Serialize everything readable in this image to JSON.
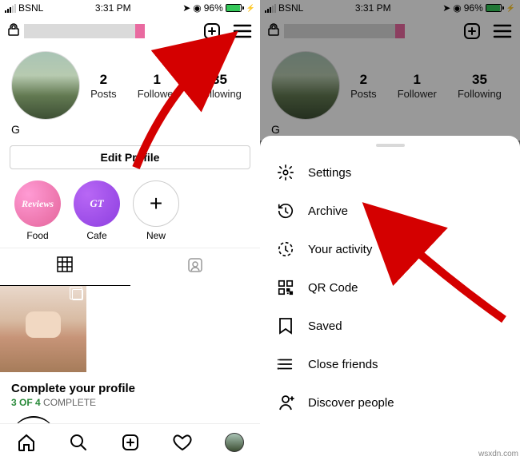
{
  "status": {
    "carrier": "BSNL",
    "time": "3:31 PM",
    "alarm_icon": "alarm",
    "loc_icon": "location",
    "battery_pct": "96%",
    "bolt": "bolt"
  },
  "topbar": {
    "lock_icon": "lock",
    "username": "(redacted)",
    "create_icon": "create",
    "menu_icon": "menu"
  },
  "profile": {
    "posts_num": "2",
    "posts_lbl": "Posts",
    "followers_num": "1",
    "followers_lbl": "Follower",
    "following_num": "35",
    "following_lbl": "Following",
    "display_name": "G",
    "edit_label": "Edit Profile"
  },
  "highlights": {
    "food": {
      "label": "Food",
      "text": "Reviews"
    },
    "cafe": {
      "label": "Cafe",
      "text": "GT"
    },
    "new": {
      "label": "New",
      "text": "+"
    }
  },
  "tabs": {
    "grid": "grid",
    "tagged": "tagged"
  },
  "complete": {
    "heading": "Complete your profile",
    "progress_bold": "3 OF 4",
    "progress_rest": " COMPLETE"
  },
  "bottomnav": {
    "home": "home",
    "search": "search",
    "create": "create",
    "activity": "activity",
    "avatar": "profile"
  },
  "sheet": {
    "items": [
      {
        "icon": "settings",
        "label": "Settings"
      },
      {
        "icon": "archive",
        "label": "Archive"
      },
      {
        "icon": "activity",
        "label": "Your activity"
      },
      {
        "icon": "qrcode",
        "label": "QR Code"
      },
      {
        "icon": "saved",
        "label": "Saved"
      },
      {
        "icon": "closefriends",
        "label": "Close friends"
      },
      {
        "icon": "discover",
        "label": "Discover people"
      }
    ]
  },
  "watermark": "wsxdn.com"
}
